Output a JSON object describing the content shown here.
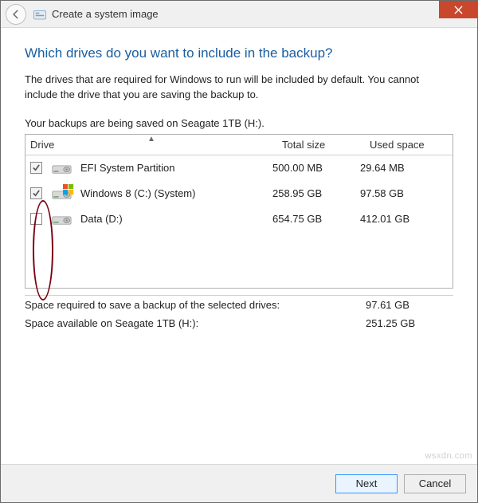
{
  "window": {
    "title": "Create a system image"
  },
  "heading": "Which drives do you want to include in the backup?",
  "description": "The drives that are required for Windows to run will be included by default. You cannot include the drive that you are saving the backup to.",
  "save_note": "Your backups are being saved on Seagate 1TB (H:).",
  "columns": {
    "drive": "Drive",
    "total": "Total size",
    "used": "Used space"
  },
  "drives": [
    {
      "checked": true,
      "disabled": true,
      "name": "EFI System Partition",
      "total": "500.00 MB",
      "used": "29.64 MB",
      "has_win_overlay": false
    },
    {
      "checked": true,
      "disabled": true,
      "name": "Windows 8 (C:) (System)",
      "total": "258.95 GB",
      "used": "97.58 GB",
      "has_win_overlay": true
    },
    {
      "checked": false,
      "disabled": false,
      "name": "Data (D:)",
      "total": "654.75 GB",
      "used": "412.01 GB",
      "has_win_overlay": false
    }
  ],
  "summary": {
    "required_label": "Space required to save a backup of the selected drives:",
    "required_value": "97.61 GB",
    "available_label": "Space available on Seagate 1TB (H:):",
    "available_value": "251.25 GB"
  },
  "buttons": {
    "next": "Next",
    "cancel": "Cancel"
  },
  "watermark": "wsxdn.com"
}
